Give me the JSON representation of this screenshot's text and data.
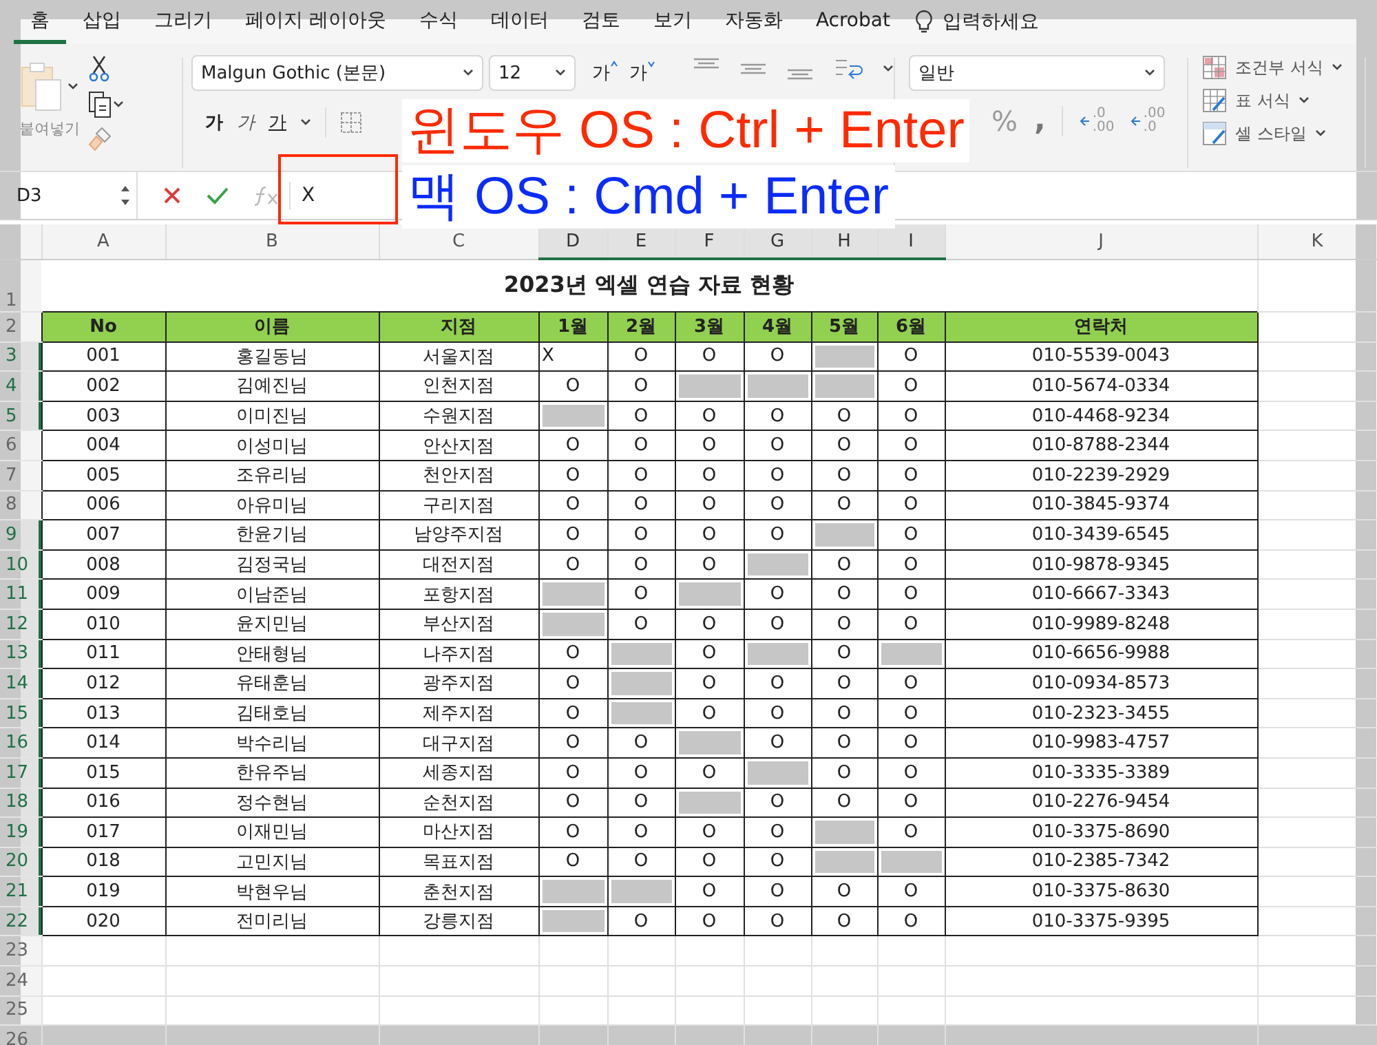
{
  "menu_tabs": [
    {
      "label": "홈",
      "selected": true
    },
    {
      "label": "삽입",
      "selected": false
    },
    {
      "label": "그리기",
      "selected": false
    },
    {
      "label": "페이지 레이아웃",
      "selected": false
    },
    {
      "label": "수식",
      "selected": false
    },
    {
      "label": "데이터",
      "selected": false
    },
    {
      "label": "검토",
      "selected": false
    },
    {
      "label": "보기",
      "selected": false
    },
    {
      "label": "자동화",
      "selected": false
    },
    {
      "label": "Acrobat",
      "selected": false
    }
  ],
  "tell_me": {
    "placeholder": "입력하세요"
  },
  "ribbon": {
    "paste_label": "붙여넣기",
    "font": "Malgun Gothic (본문)",
    "font_size": "12",
    "grow_font": "가",
    "shrink_font": "가",
    "bold": "가",
    "italic": "가",
    "underline": "가",
    "number_format": "일반",
    "percent": "%",
    "comma": ",",
    "increase_decimal": [
      ".0",
      ".00"
    ],
    "decrease_decimal": [
      ".00",
      ".0"
    ],
    "styles": [
      "조건부 서식",
      "표 서식",
      "셀 스타일"
    ]
  },
  "formula_bar": {
    "name_box": "D3",
    "value": "X"
  },
  "annotations": [
    {
      "text": "윈도우 OS : Ctrl + Enter",
      "color": "#ff2a00"
    },
    {
      "text": "맥 OS : Cmd + Enter",
      "color": "#0a2cff"
    }
  ],
  "sheet": {
    "columns": [
      {
        "label": "A",
        "selected": false
      },
      {
        "label": "B",
        "selected": false
      },
      {
        "label": "C",
        "selected": false
      },
      {
        "label": "D",
        "selected": true
      },
      {
        "label": "E",
        "selected": true
      },
      {
        "label": "F",
        "selected": true
      },
      {
        "label": "G",
        "selected": true
      },
      {
        "label": "H",
        "selected": true
      },
      {
        "label": "I",
        "selected": true
      },
      {
        "label": "J",
        "selected": false
      },
      {
        "label": "K",
        "selected": false
      }
    ],
    "title_row": "1",
    "title": "2023년 엑셀 연습 자료 현황",
    "header_row": "2",
    "headers": [
      "No",
      "이름",
      "지점",
      "1월",
      "2월",
      "3월",
      "4월",
      "5월",
      "6월",
      "연락처"
    ],
    "rows": [
      {
        "row": "3",
        "selected": true,
        "no": "001",
        "name": "홍길동님",
        "branch": "서울지점",
        "months": [
          {
            "text": "X",
            "selected": false
          },
          {
            "text": "O",
            "selected": false
          },
          {
            "text": "O",
            "selected": false
          },
          {
            "text": "O",
            "selected": false
          },
          {
            "selected": true
          },
          {
            "text": "O",
            "selected": false
          }
        ],
        "phone": "010-5539-0043"
      },
      {
        "row": "4",
        "selected": true,
        "no": "002",
        "name": "김예진님",
        "branch": "인천지점",
        "months": [
          {
            "text": "O",
            "selected": false
          },
          {
            "text": "O",
            "selected": false
          },
          {
            "selected": true
          },
          {
            "selected": true
          },
          {
            "selected": true
          },
          {
            "text": "O",
            "selected": false
          }
        ],
        "phone": "010-5674-0334"
      },
      {
        "row": "5",
        "selected": true,
        "no": "003",
        "name": "이미진님",
        "branch": "수원지점",
        "months": [
          {
            "selected": true
          },
          {
            "text": "O",
            "selected": false
          },
          {
            "text": "O",
            "selected": false
          },
          {
            "text": "O",
            "selected": false
          },
          {
            "text": "O",
            "selected": false
          },
          {
            "text": "O",
            "selected": false
          }
        ],
        "phone": "010-4468-9234"
      },
      {
        "row": "6",
        "selected": false,
        "no": "004",
        "name": "이성미님",
        "branch": "안산지점",
        "months": [
          {
            "text": "O",
            "selected": false
          },
          {
            "text": "O",
            "selected": false
          },
          {
            "text": "O",
            "selected": false
          },
          {
            "text": "O",
            "selected": false
          },
          {
            "text": "O",
            "selected": false
          },
          {
            "text": "O",
            "selected": false
          }
        ],
        "phone": "010-8788-2344"
      },
      {
        "row": "7",
        "selected": false,
        "no": "005",
        "name": "조유리님",
        "branch": "천안지점",
        "months": [
          {
            "text": "O",
            "selected": false
          },
          {
            "text": "O",
            "selected": false
          },
          {
            "text": "O",
            "selected": false
          },
          {
            "text": "O",
            "selected": false
          },
          {
            "text": "O",
            "selected": false
          },
          {
            "text": "O",
            "selected": false
          }
        ],
        "phone": "010-2239-2929"
      },
      {
        "row": "8",
        "selected": false,
        "no": "006",
        "name": "아유미님",
        "branch": "구리지점",
        "months": [
          {
            "text": "O",
            "selected": false
          },
          {
            "text": "O",
            "selected": false
          },
          {
            "text": "O",
            "selected": false
          },
          {
            "text": "O",
            "selected": false
          },
          {
            "text": "O",
            "selected": false
          },
          {
            "text": "O",
            "selected": false
          }
        ],
        "phone": "010-3845-9374"
      },
      {
        "row": "9",
        "selected": true,
        "no": "007",
        "name": "한윤기님",
        "branch": "남양주지점",
        "months": [
          {
            "text": "O",
            "selected": false
          },
          {
            "text": "O",
            "selected": false
          },
          {
            "text": "O",
            "selected": false
          },
          {
            "text": "O",
            "selected": false
          },
          {
            "selected": true
          },
          {
            "text": "O",
            "selected": false
          }
        ],
        "phone": "010-3439-6545"
      },
      {
        "row": "10",
        "selected": true,
        "no": "008",
        "name": "김정국님",
        "branch": "대전지점",
        "months": [
          {
            "text": "O",
            "selected": false
          },
          {
            "text": "O",
            "selected": false
          },
          {
            "text": "O",
            "selected": false
          },
          {
            "selected": true
          },
          {
            "text": "O",
            "selected": false
          },
          {
            "text": "O",
            "selected": false
          }
        ],
        "phone": "010-9878-9345"
      },
      {
        "row": "11",
        "selected": true,
        "no": "009",
        "name": "이남준님",
        "branch": "포항지점",
        "months": [
          {
            "selected": true
          },
          {
            "text": "O",
            "selected": false
          },
          {
            "selected": true
          },
          {
            "text": "O",
            "selected": false
          },
          {
            "text": "O",
            "selected": false
          },
          {
            "text": "O",
            "selected": false
          }
        ],
        "phone": "010-6667-3343"
      },
      {
        "row": "12",
        "selected": true,
        "no": "010",
        "name": "윤지민님",
        "branch": "부산지점",
        "months": [
          {
            "selected": true
          },
          {
            "text": "O",
            "selected": false
          },
          {
            "text": "O",
            "selected": false
          },
          {
            "text": "O",
            "selected": false
          },
          {
            "text": "O",
            "selected": false
          },
          {
            "text": "O",
            "selected": false
          }
        ],
        "phone": "010-9989-8248"
      },
      {
        "row": "13",
        "selected": true,
        "no": "011",
        "name": "안태형님",
        "branch": "나주지점",
        "months": [
          {
            "text": "O",
            "selected": false
          },
          {
            "selected": true
          },
          {
            "text": "O",
            "selected": false
          },
          {
            "selected": true
          },
          {
            "text": "O",
            "selected": false
          },
          {
            "selected": true
          }
        ],
        "phone": "010-6656-9988"
      },
      {
        "row": "14",
        "selected": true,
        "no": "012",
        "name": "유태훈님",
        "branch": "광주지점",
        "months": [
          {
            "text": "O",
            "selected": false
          },
          {
            "selected": true
          },
          {
            "text": "O",
            "selected": false
          },
          {
            "text": "O",
            "selected": false
          },
          {
            "text": "O",
            "selected": false
          },
          {
            "text": "O",
            "selected": false
          }
        ],
        "phone": "010-0934-8573"
      },
      {
        "row": "15",
        "selected": true,
        "no": "013",
        "name": "김태호님",
        "branch": "제주지점",
        "months": [
          {
            "text": "O",
            "selected": false
          },
          {
            "selected": true
          },
          {
            "text": "O",
            "selected": false
          },
          {
            "text": "O",
            "selected": false
          },
          {
            "text": "O",
            "selected": false
          },
          {
            "text": "O",
            "selected": false
          }
        ],
        "phone": "010-2323-3455"
      },
      {
        "row": "16",
        "selected": true,
        "no": "014",
        "name": "박수리님",
        "branch": "대구지점",
        "months": [
          {
            "text": "O",
            "selected": false
          },
          {
            "text": "O",
            "selected": false
          },
          {
            "selected": true
          },
          {
            "text": "O",
            "selected": false
          },
          {
            "text": "O",
            "selected": false
          },
          {
            "text": "O",
            "selected": false
          }
        ],
        "phone": "010-9983-4757"
      },
      {
        "row": "17",
        "selected": true,
        "no": "015",
        "name": "한유주님",
        "branch": "세종지점",
        "months": [
          {
            "text": "O",
            "selected": false
          },
          {
            "text": "O",
            "selected": false
          },
          {
            "text": "O",
            "selected": false
          },
          {
            "selected": true
          },
          {
            "text": "O",
            "selected": false
          },
          {
            "text": "O",
            "selected": false
          }
        ],
        "phone": "010-3335-3389"
      },
      {
        "row": "18",
        "selected": true,
        "no": "016",
        "name": "정수현님",
        "branch": "순천지점",
        "months": [
          {
            "text": "O",
            "selected": false
          },
          {
            "text": "O",
            "selected": false
          },
          {
            "selected": true
          },
          {
            "text": "O",
            "selected": false
          },
          {
            "text": "O",
            "selected": false
          },
          {
            "text": "O",
            "selected": false
          }
        ],
        "phone": "010-2276-9454"
      },
      {
        "row": "19",
        "selected": true,
        "no": "017",
        "name": "이재민님",
        "branch": "마산지점",
        "months": [
          {
            "text": "O",
            "selected": false
          },
          {
            "text": "O",
            "selected": false
          },
          {
            "text": "O",
            "selected": false
          },
          {
            "text": "O",
            "selected": false
          },
          {
            "selected": true
          },
          {
            "text": "O",
            "selected": false
          }
        ],
        "phone": "010-3375-8690"
      },
      {
        "row": "20",
        "selected": true,
        "no": "018",
        "name": "고민지님",
        "branch": "목표지점",
        "months": [
          {
            "text": "O",
            "selected": false
          },
          {
            "text": "O",
            "selected": false
          },
          {
            "text": "O",
            "selected": false
          },
          {
            "text": "O",
            "selected": false
          },
          {
            "selected": true
          },
          {
            "selected": true
          }
        ],
        "phone": "010-2385-7342"
      },
      {
        "row": "21",
        "selected": true,
        "no": "019",
        "name": "박현우님",
        "branch": "춘천지점",
        "months": [
          {
            "selected": true
          },
          {
            "selected": true
          },
          {
            "text": "O",
            "selected": false
          },
          {
            "text": "O",
            "selected": false
          },
          {
            "text": "O",
            "selected": false
          },
          {
            "text": "O",
            "selected": false
          }
        ],
        "phone": "010-3375-8630"
      },
      {
        "row": "22",
        "selected": true,
        "no": "020",
        "name": "전미리님",
        "branch": "강릉지점",
        "months": [
          {
            "selected": true
          },
          {
            "text": "O",
            "selected": false
          },
          {
            "text": "O",
            "selected": false
          },
          {
            "text": "O",
            "selected": false
          },
          {
            "text": "O",
            "selected": false
          },
          {
            "text": "O",
            "selected": false
          }
        ],
        "phone": "010-3375-9395"
      }
    ],
    "empty_rows": [
      "23",
      "24",
      "25",
      "26"
    ]
  }
}
